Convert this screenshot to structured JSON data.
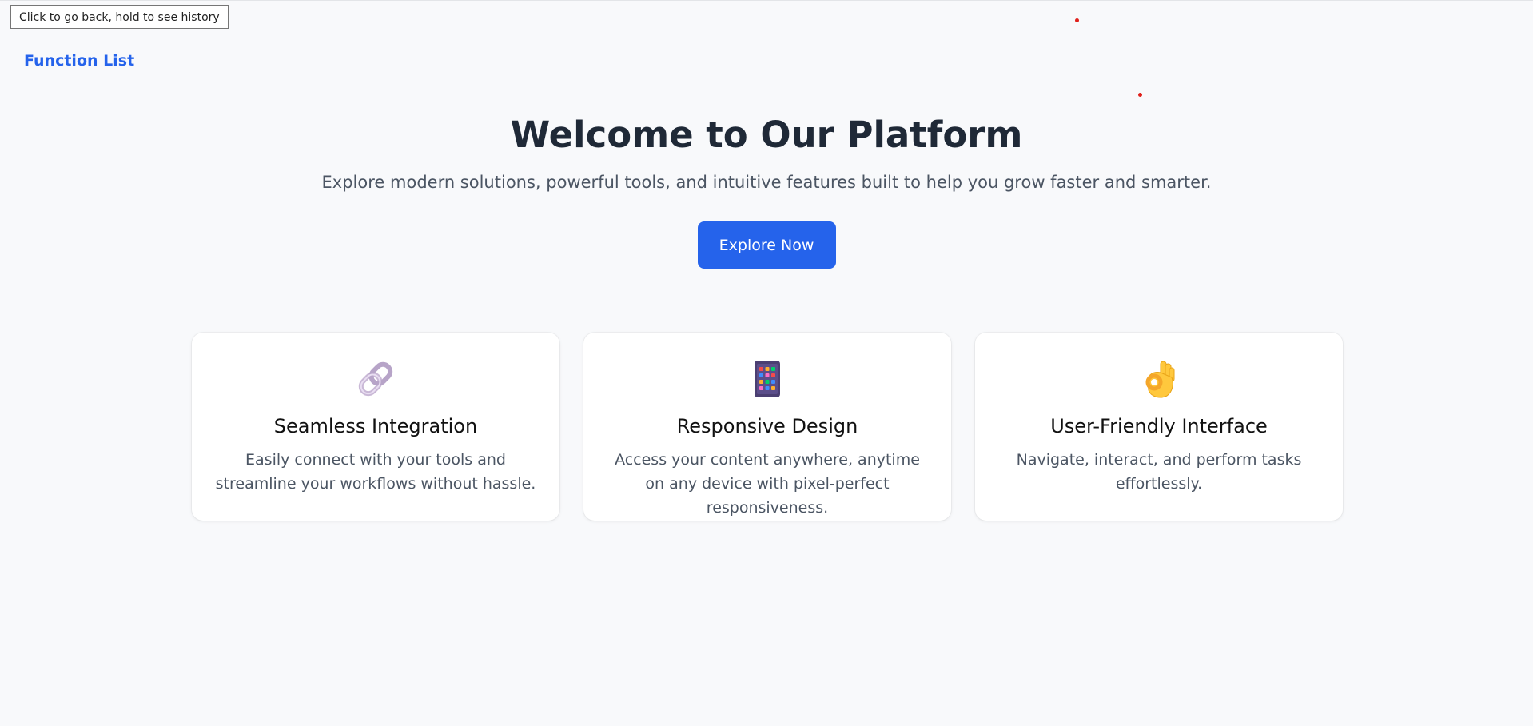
{
  "tooltip": {
    "text": "Click to go back, hold to see history"
  },
  "nav": {
    "function_list_label": "Function List"
  },
  "hero": {
    "title": "Welcome to Our Platform",
    "subtitle": "Explore modern solutions, powerful tools, and intuitive features built to help you grow faster and smarter.",
    "cta_label": "Explore Now"
  },
  "features": [
    {
      "icon": "link-icon",
      "title": "Seamless Integration",
      "description": "Easily connect with your tools and streamline your workflows without hassle."
    },
    {
      "icon": "mobile-phone-icon",
      "title": "Responsive Design",
      "description": "Access your content anywhere, anytime on any device with pixel-perfect responsiveness."
    },
    {
      "icon": "ok-hand-icon",
      "title": "User-Friendly Interface",
      "description": "Navigate, interact, and perform tasks effortlessly."
    }
  ],
  "colors": {
    "accent": "#2563eb",
    "background": "#f8f9fb",
    "heading": "#1f2937",
    "muted_text": "#4b5563",
    "marker_dot": "#e0201b"
  }
}
